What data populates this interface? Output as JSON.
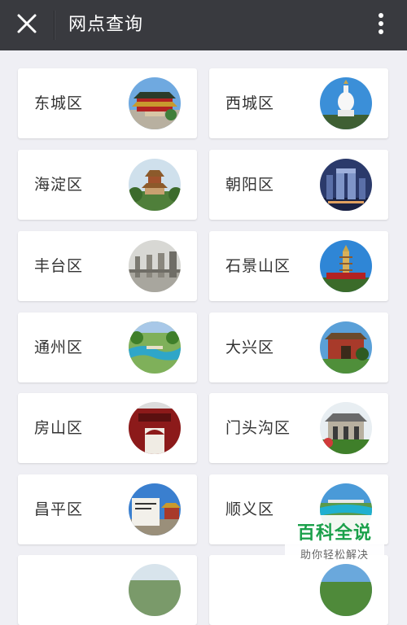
{
  "header": {
    "title": "网点查询",
    "close_icon": "close-icon",
    "more_icon": "more-vertical-icon",
    "background": "#393a3f"
  },
  "districts": [
    {
      "label": "东城区",
      "image": "forbidden-city-gate-photo"
    },
    {
      "label": "西城区",
      "image": "white-pagoda-photo"
    },
    {
      "label": "海淀区",
      "image": "summer-palace-tower-photo"
    },
    {
      "label": "朝阳区",
      "image": "cctv-tower-photo"
    },
    {
      "label": "丰台区",
      "image": "lugou-bridge-lions-photo"
    },
    {
      "label": "石景山区",
      "image": "pagoda-photo"
    },
    {
      "label": "通州区",
      "image": "canal-park-photo"
    },
    {
      "label": "大兴区",
      "image": "gate-park-photo"
    },
    {
      "label": "房山区",
      "image": "red-gate-photo"
    },
    {
      "label": "门头沟区",
      "image": "memorial-hall-photo"
    },
    {
      "label": "昌平区",
      "image": "ming-tombs-stele-photo"
    },
    {
      "label": "顺义区",
      "image": "olympic-rowing-park-photo"
    },
    {
      "label": "",
      "image": "partial-photo"
    },
    {
      "label": "",
      "image": "partial-photo"
    }
  ],
  "watermark": {
    "title": "百科全说",
    "subtitle": "助你轻松解决"
  }
}
